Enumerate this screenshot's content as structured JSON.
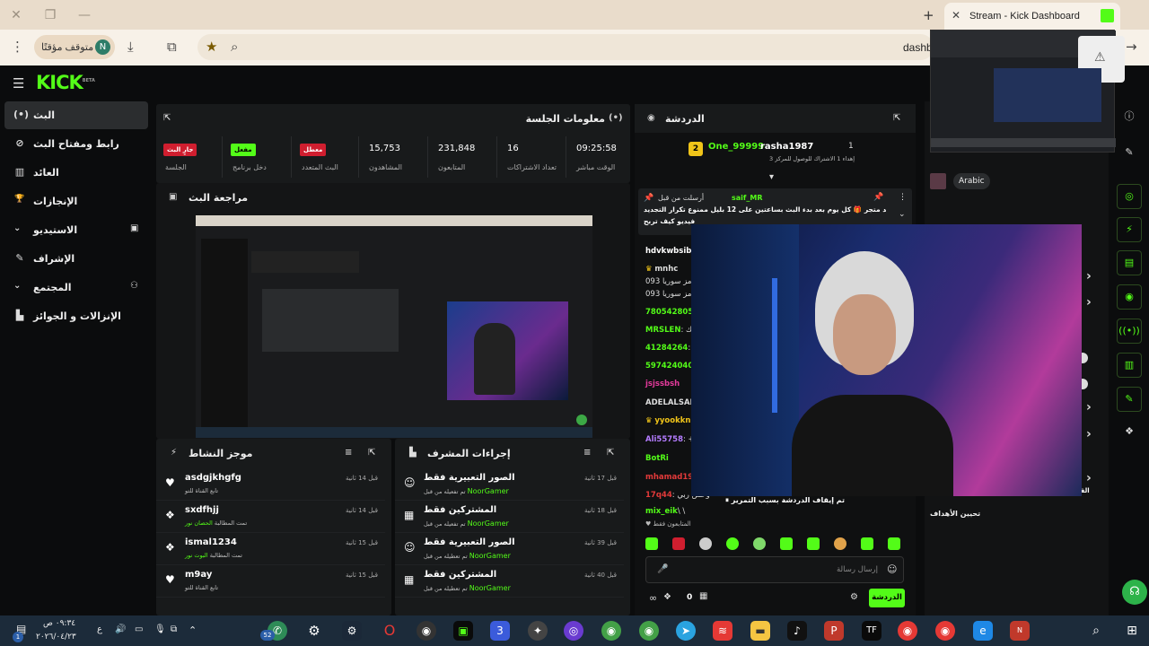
{
  "browser": {
    "tab_title": "Stream - Kick Dashboard",
    "url": "dashb",
    "paused_label": "متوقف مؤقتًا",
    "profile_initial": "N"
  },
  "app": {
    "logo": "KICK",
    "logo_tag": "BETA",
    "sidebar": [
      {
        "label": "البث",
        "icon": "(•)",
        "active": true
      },
      {
        "label": "رابط ومفتاح البث",
        "icon": "⊘"
      },
      {
        "label": "العائد",
        "icon": "▥"
      },
      {
        "label": "الإنجازات",
        "icon": "🏆"
      },
      {
        "label": "الاستيديو",
        "icon": "▣",
        "chevron": "⌄"
      },
      {
        "label": "الإشراف",
        "icon": "✎"
      },
      {
        "label": "المجتمع",
        "icon": "⚇",
        "chevron": "⌄"
      },
      {
        "label": "الإنزالات و الجوائز",
        "icon": "▙"
      }
    ],
    "session": {
      "title": "معلومات الجلسة",
      "stats": [
        {
          "value": "09:25:58",
          "key": "الوقت مباشر"
        },
        {
          "value": "16",
          "key": "تعداد الاشتراكات"
        },
        {
          "value": "231,848",
          "key": "المتابعون"
        },
        {
          "value": "15,753",
          "key": "المشاهدون"
        },
        {
          "badge": "معطل",
          "key": "البث المتعدد"
        },
        {
          "badge": "مفعل",
          "key": "دخل برنامج"
        },
        {
          "badge": "جارٍ البث",
          "key": "الجلسة"
        }
      ]
    },
    "preview": {
      "title": "مراجعة البث"
    },
    "activity": {
      "title": "موجز النشاط",
      "rows": [
        {
          "name": "asdgjkhgfg",
          "sub": "تابع القناة للتو",
          "time": "قبل 14 ثانية",
          "icon": "♥"
        },
        {
          "name": "sxdfhjj",
          "sub": "تمت المطالبة",
          "sub_hl": "الحصان نور",
          "time": "قبل 14 ثانية",
          "icon": "❖"
        },
        {
          "name": "ismal1234",
          "sub": "تمت المطالبة",
          "sub_hl": "البوت نور",
          "time": "قبل 15 ثانية",
          "icon": "❖"
        },
        {
          "name": "m9ay",
          "sub": "تابع القناة للتو",
          "time": "قبل 15 ثانية",
          "icon": "♥"
        }
      ]
    },
    "modactions": {
      "title": "إجراءات المشرف",
      "rows": [
        {
          "name": "الصور التعبيرية فقط",
          "sub": "تم تفعيله من قبل",
          "by": "NoorGamer",
          "time": "قبل 17 ثانية",
          "icon": "☺"
        },
        {
          "name": "المشتركين فقط",
          "sub": "تم تفعيله من قبل",
          "by": "NoorGamer",
          "time": "قبل 18 ثانية",
          "icon": "▦"
        },
        {
          "name": "الصور التعبيرية فقط",
          "sub": "تم تعطيله من قبل",
          "by": "NoorGamer",
          "time": "قبل 39 ثانية",
          "icon": "☺"
        },
        {
          "name": "المشتركين فقط",
          "sub": "تم تعطيله من قبل",
          "by": "NoorGamer",
          "time": "قبل 40 ثانية",
          "icon": "▦"
        }
      ]
    },
    "chat": {
      "title": "الدردشة",
      "leaders": [
        {
          "rank": "1",
          "name": "rasha1987",
          "sub": "إهداء 1 الاشتراك للوصول للمركز 3"
        },
        {
          "rank": "2",
          "name": "One_99999"
        }
      ],
      "pinned_by": "saif_MR",
      "pinned_label": "أرسلت من قبل",
      "pinned_text_1": "يتم تجديد متجر 🎁 كل يوم بعد بدء البث بساعتين على 12 بليل ممنوع تكرار التجديد",
      "pinned_text_2": "فيديو كيف تربح",
      "lines": [
        {
          "user": "hdvkwbsibd",
          "text": "",
          "color": "#ffffff"
        },
        {
          "user": "mnhc",
          "text": "",
          "color": "#ffffff"
        },
        {
          "user": "",
          "text": "093 رمز سوريا",
          "color": "#ffffff"
        },
        {
          "user": "",
          "text": "093 رمز سوريا",
          "color": "#ffffff"
        },
        {
          "user": "780542805",
          "text": "",
          "color": "#53fc18"
        },
        {
          "user": "MRSLEN",
          "text": ": لك",
          "color": "#53fc18"
        },
        {
          "user": "41284264",
          "text": ": 5",
          "color": "#53fc18"
        },
        {
          "user": "597424040",
          "text": "",
          "color": "#53fc18"
        },
        {
          "user": "jsjssbsh",
          "text": "",
          "color": "#e33a9b"
        },
        {
          "user": "ADELALSAH",
          "text": "",
          "color": "#ffffff"
        },
        {
          "user": "yyookkn",
          "text": "",
          "color": "#f0c419"
        },
        {
          "user": "Ali55758",
          "text": ": +1",
          "color": "#b47cff"
        },
        {
          "user": "BotRi",
          "text": "",
          "color": "#53fc18"
        },
        {
          "user": "mhamad198",
          "text": "",
          "color": "#e33a3a"
        },
        {
          "user": "17q44",
          "text": ": وحش ربي",
          "color": "#e33a3a"
        },
        {
          "user": "mix_eik",
          "text": "\\ \\",
          "color": "#53fc18"
        }
      ],
      "paused_notice": "تم إيقاف الدردشة بسبب التمرير",
      "followers_only": "المتابعون فقط",
      "input_placeholder": "إرسال رسالة",
      "send_label": "الدردشة",
      "points": "0"
    },
    "right": {
      "lang": "Arabic",
      "goals_label": "تحيين الأهداف",
      "channel_label": "القناة"
    }
  },
  "taskbar": {
    "time": "٠٩:٣٤ ص",
    "date": "٢٠٢٦/٠٤/٢٣",
    "lang": "ع",
    "notif_count": "52",
    "start_badge": "1"
  }
}
